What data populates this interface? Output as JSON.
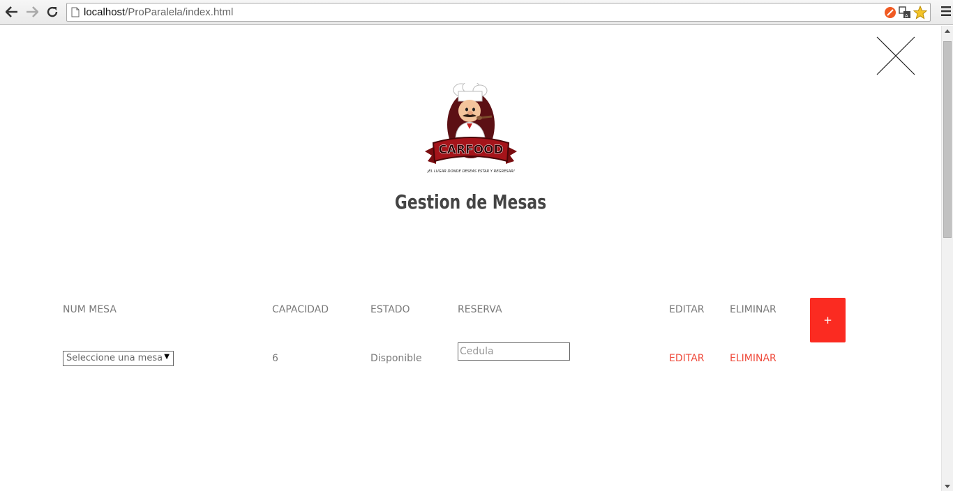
{
  "browser": {
    "url_host": "localhost",
    "url_path": "/ProParalela/index.html"
  },
  "page": {
    "logo_text": "CARFOOD",
    "logo_tagline": "¡EL LUGAR DONDE DESEAS ESTAR Y REGRESAR!",
    "title": "Gestion de Mesas"
  },
  "table": {
    "headers": {
      "num_mesa": "NUM MESA",
      "capacidad": "CAPACIDAD",
      "estado": "ESTADO",
      "reserva": "RESERVA",
      "editar": "EDITAR",
      "eliminar": "ELIMINAR"
    },
    "add_button_label": "+",
    "row": {
      "mesa_select_value": "Seleccione una mesa",
      "capacidad": "6",
      "estado": "Disponible",
      "reserva_placeholder": "Cedula",
      "editar_link": "EDITAR",
      "eliminar_link": "ELIMINAR"
    }
  },
  "colors": {
    "accent_red": "#fb2b21",
    "link_red": "#ef4b3c",
    "text_gray": "#7a7a7a",
    "title_gray": "#444444"
  }
}
